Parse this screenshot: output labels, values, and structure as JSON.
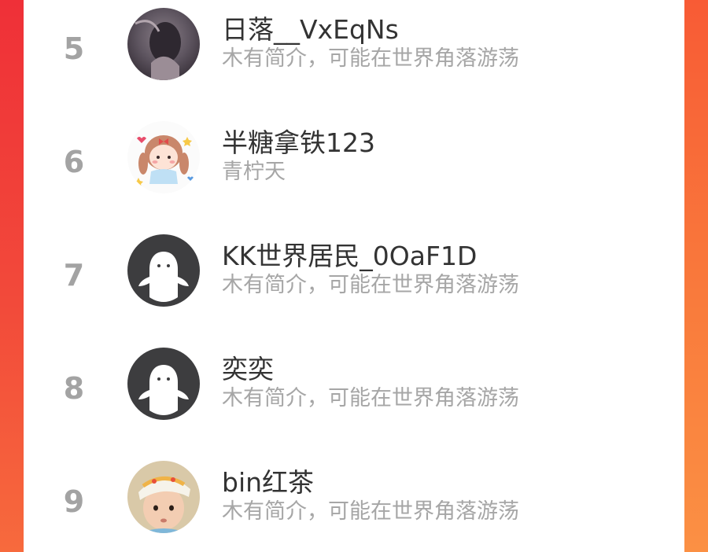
{
  "ranking": {
    "items": [
      {
        "rank": "5",
        "name": "日落__VxEqNs",
        "bio": "木有简介，可能在世界角落游荡",
        "avatar": "dark-photo-avatar"
      },
      {
        "rank": "6",
        "name": "半糖拿铁123",
        "bio": "青柠天",
        "avatar": "cartoon-girl-avatar"
      },
      {
        "rank": "7",
        "name": "KK世界居民_0OaF1D",
        "bio": "木有简介，可能在世界角落游荡",
        "avatar": "default-ghost-avatar"
      },
      {
        "rank": "8",
        "name": "奕奕",
        "bio": "木有简介，可能在世界角落游荡",
        "avatar": "default-ghost-avatar"
      },
      {
        "rank": "9",
        "name": "bin红茶",
        "bio": "木有简介，可能在世界角落游荡",
        "avatar": "baby-photo-avatar"
      }
    ]
  },
  "colors": {
    "background_top": "#f0363b",
    "background_bottom": "#f97c3e",
    "rank_text": "#a3a3a3",
    "name_text": "#333333",
    "bio_text": "#a6a6a6"
  }
}
